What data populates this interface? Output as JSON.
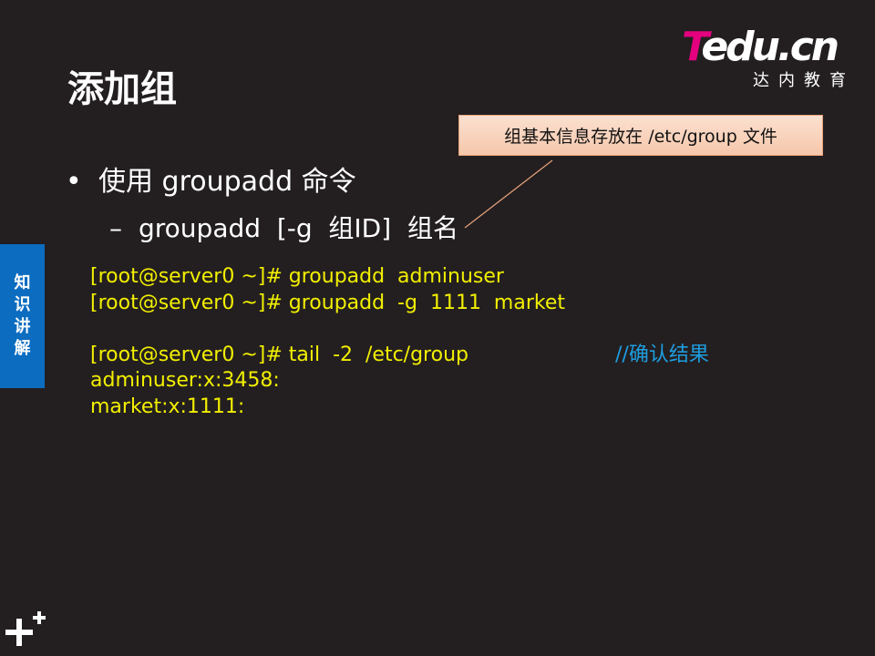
{
  "logo": {
    "mark_t": "T",
    "mark_rest": "edu.cn",
    "subtitle": "达内教育"
  },
  "slide": {
    "title": "添加组",
    "callout": "组基本信息存放在 /etc/group 文件",
    "bullet": "使用 groupadd 命令",
    "sub_bullet": "groupadd  [-g  组ID]  组名",
    "side_tab": [
      "知",
      "识",
      "讲",
      "解"
    ]
  },
  "code": {
    "lines": [
      "[root@server0 ~]# groupadd  adminuser",
      "[root@server0 ~]# groupadd  -g  1111  market",
      "",
      "[root@server0 ~]# tail  -2  /etc/group",
      "adminuser:x:3458:",
      "market:x:1111:"
    ],
    "comment": "//确认结果"
  },
  "colors": {
    "background": "#231f20",
    "code_text": "#f2ef00",
    "comment": "#1e9de0",
    "side_tab": "#0b6cc0",
    "logo_accent": "#e4007f",
    "callout_fill": "#f6c7ab"
  },
  "icons": {
    "bottom_logo": "plus-plus-icon"
  }
}
